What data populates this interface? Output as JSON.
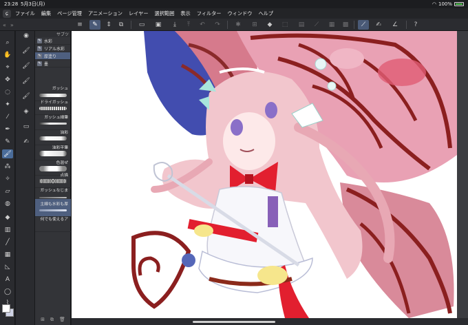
{
  "status": {
    "time": "23:28",
    "date": "5月3日(月)",
    "battery": "100%"
  },
  "menubar": {
    "items": [
      "ファイル",
      "編集",
      "ページ管理",
      "アニメーション",
      "レイヤー",
      "選択範囲",
      "表示",
      "フィルター",
      "ウィンドウ",
      "ヘルプ"
    ]
  },
  "brush_panel": {
    "header": "サブツ",
    "categories": [
      {
        "label": "水彩",
        "icon": "brush-icon"
      },
      {
        "label": "リアル水彩",
        "icon": "brush-icon"
      },
      {
        "label": "厚塗り",
        "icon": "brush-icon"
      },
      {
        "label": "墨",
        "icon": "brush-icon"
      }
    ],
    "brushes": [
      {
        "label": "ガッシュ"
      },
      {
        "label": "ドライガッシュ"
      },
      {
        "label": "ガッシュ細筆"
      },
      {
        "label": "油彩"
      },
      {
        "label": "油彩平筆"
      },
      {
        "label": "色混ぜ"
      },
      {
        "label": "点描"
      },
      {
        "label": "ガッシュなじま"
      },
      {
        "label": "主線も水彩も厚"
      },
      {
        "label": "何でも使えるア"
      }
    ]
  },
  "colors": {
    "accent": "#4a6c9a",
    "selected": "#4e5f7f",
    "canvas_bg": "#ffffff"
  }
}
